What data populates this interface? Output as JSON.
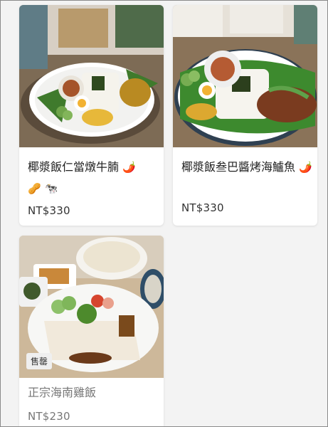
{
  "items": [
    {
      "name": "椰漿飯仁當燉牛腩",
      "tag_icons": [
        "🌶️",
        "🥜",
        "🐄"
      ],
      "price": "NT$330",
      "sold_out": ""
    },
    {
      "name": "椰漿飯叁巴醬烤海鱸魚",
      "tag_icons": [
        "🌶️"
      ],
      "price": "NT$330",
      "sold_out": ""
    },
    {
      "name": "正宗海南雞飯",
      "tag_icons": [],
      "price": "NT$230",
      "sold_out": "售罄"
    }
  ],
  "icons": {
    "chili": "chili-pepper-icon",
    "peanut": "peanut-icon",
    "beef": "cow-icon"
  },
  "colors": {
    "background": "#f3f3f3",
    "card": "#ffffff",
    "text": "#222222",
    "muted": "#777777",
    "badge": "#efefef"
  }
}
